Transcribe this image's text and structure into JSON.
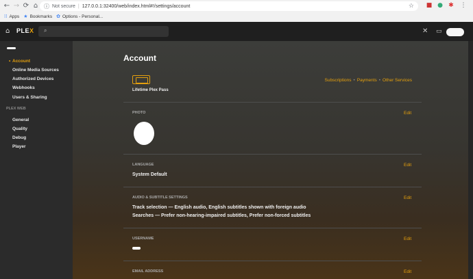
{
  "browser": {
    "security_label": "Not secure",
    "url": "127.0.0.1:32400/web/index.html#!/settings/account",
    "bookmarks": [
      {
        "label": "Apps",
        "icon": "apps-grid-icon"
      },
      {
        "label": "Bookmarks",
        "icon": "star-icon"
      },
      {
        "label": "Options - Personal...",
        "icon": "gear-icon"
      }
    ]
  },
  "topbar": {
    "logo_main": "PLE",
    "logo_accent": "X"
  },
  "sidebar": {
    "items": [
      {
        "label": "Account",
        "active": true
      },
      {
        "label": "Online Media Sources"
      },
      {
        "label": "Authorized Devices"
      },
      {
        "label": "Webhooks"
      },
      {
        "label": "Users & Sharing"
      }
    ],
    "section_label": "PLEX WEB",
    "web_items": [
      {
        "label": "General"
      },
      {
        "label": "Quality"
      },
      {
        "label": "Debug"
      },
      {
        "label": "Player"
      }
    ]
  },
  "main": {
    "title": "Account",
    "pass_label": "Lifetime Plex Pass",
    "links": [
      "Subscriptions",
      "Payments",
      "Other Services"
    ],
    "edit_label": "Edit",
    "sections": {
      "photo": "PHOTO",
      "language": "LANGUAGE",
      "language_value": "System Default",
      "audio": "AUDIO & SUBTITLE SETTINGS",
      "audio_line1": "Track selection — English audio, English subtitles shown with foreign audio",
      "audio_line2": "Searches — Prefer non-hearing-impaired subtitles, Prefer non-forced subtitles",
      "username": "USERNAME",
      "email": "EMAIL ADDRESS"
    }
  },
  "colors": {
    "accent": "#e5a00d"
  }
}
